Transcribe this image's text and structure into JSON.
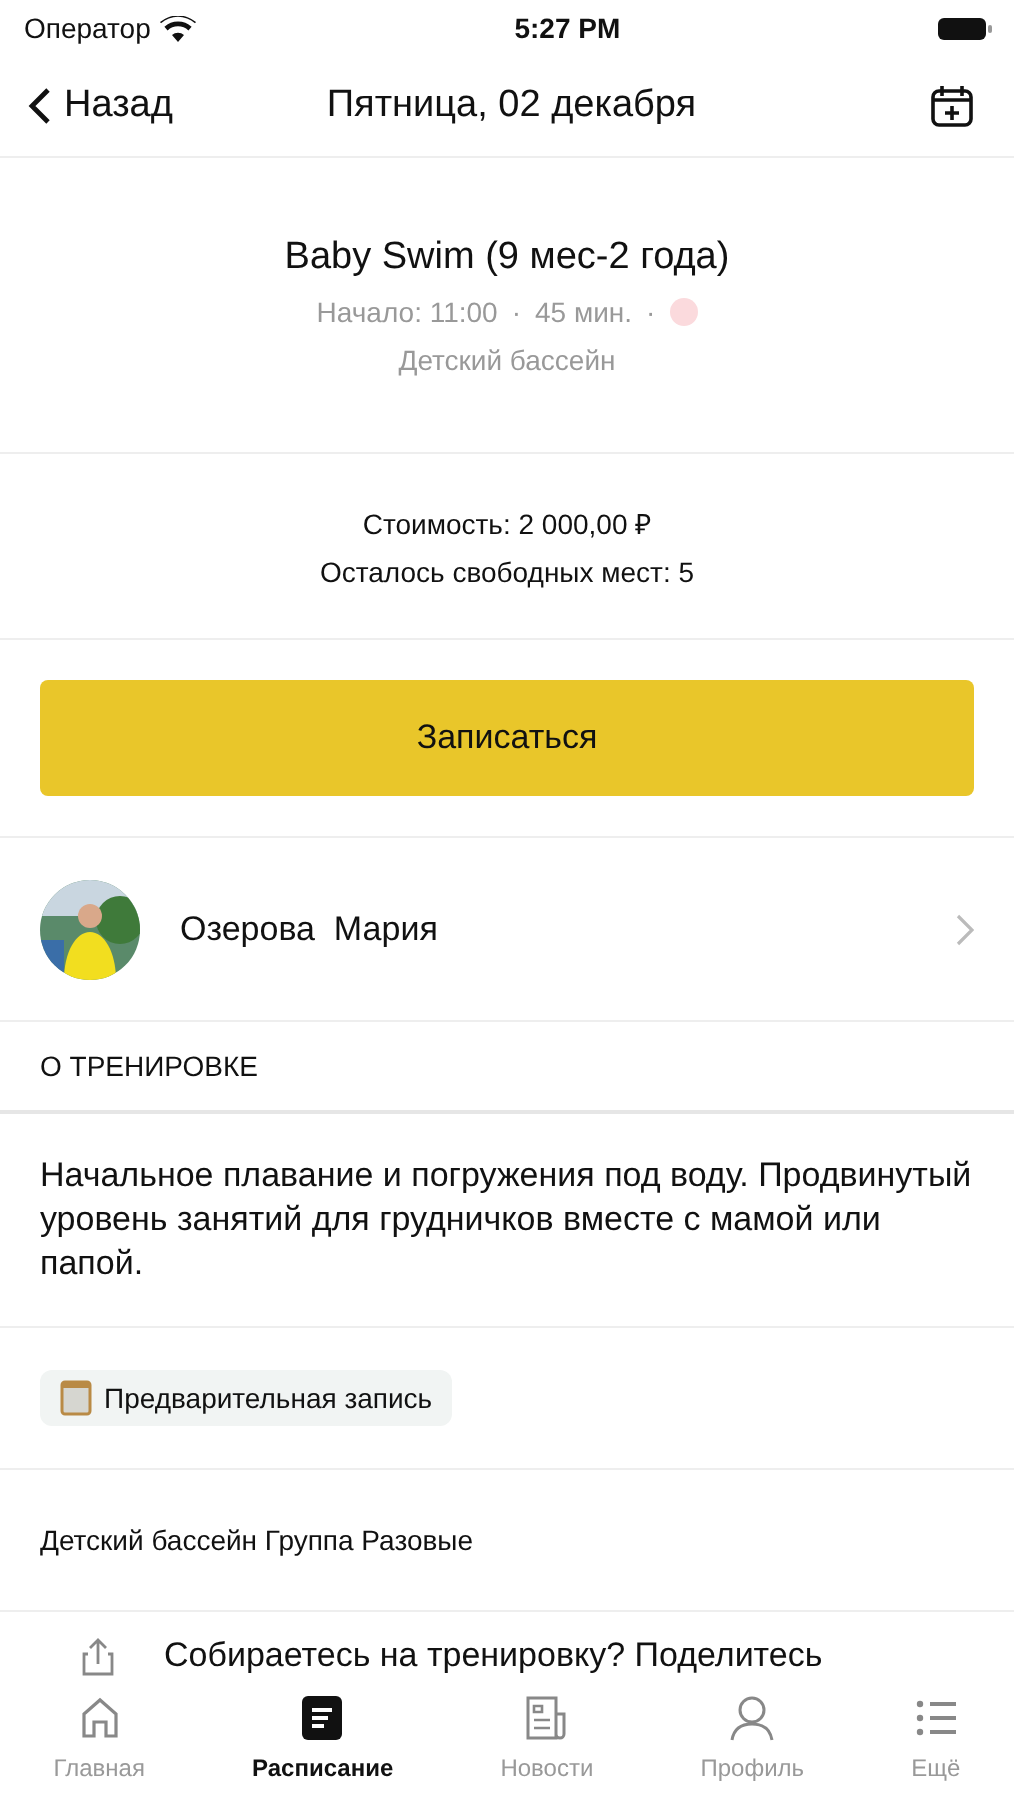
{
  "status_bar": {
    "carrier": "Оператор",
    "time": "5:27 PM"
  },
  "nav": {
    "back": "Назад",
    "title": "Пятница, 02 декабря"
  },
  "class": {
    "title": "Baby Swim (9 мес-2 года)",
    "meta": [
      {
        "kind": "text",
        "text": "Начало: 11:00"
      },
      {
        "kind": "separator",
        "text": "·"
      },
      {
        "kind": "text",
        "text": "45 мин."
      },
      {
        "kind": "separator",
        "text": "·"
      },
      {
        "kind": "dot",
        "color": "#fbdadd"
      }
    ],
    "location": "Детский бассейн"
  },
  "price": {
    "cost": "Стоимость: 2 000,00 ₽",
    "seats": "Осталось свободных мест: 5"
  },
  "signup_button": "Записаться",
  "coach": {
    "name": "Озерова  Мария"
  },
  "section_title": "О ТРЕНИРОВКЕ",
  "description": "Начальное плавание и погружения под воду. Продвинутый уровень занятий для грудничков вместе с мамой или папой.",
  "tag": "Предварительная запись",
  "group": "Детский бассейн Группа Разовые",
  "share": "Собираетесь на тренировку? Поделитесь",
  "tabs": [
    {
      "label": "Главная",
      "kind": "home",
      "selected": false
    },
    {
      "label": "Расписание",
      "kind": "schedule",
      "selected": true
    },
    {
      "label": "Новости",
      "kind": "news",
      "selected": false
    },
    {
      "label": "Профиль",
      "kind": "profile",
      "selected": false
    },
    {
      "label": "Ещё",
      "kind": "more",
      "selected": false
    }
  ]
}
